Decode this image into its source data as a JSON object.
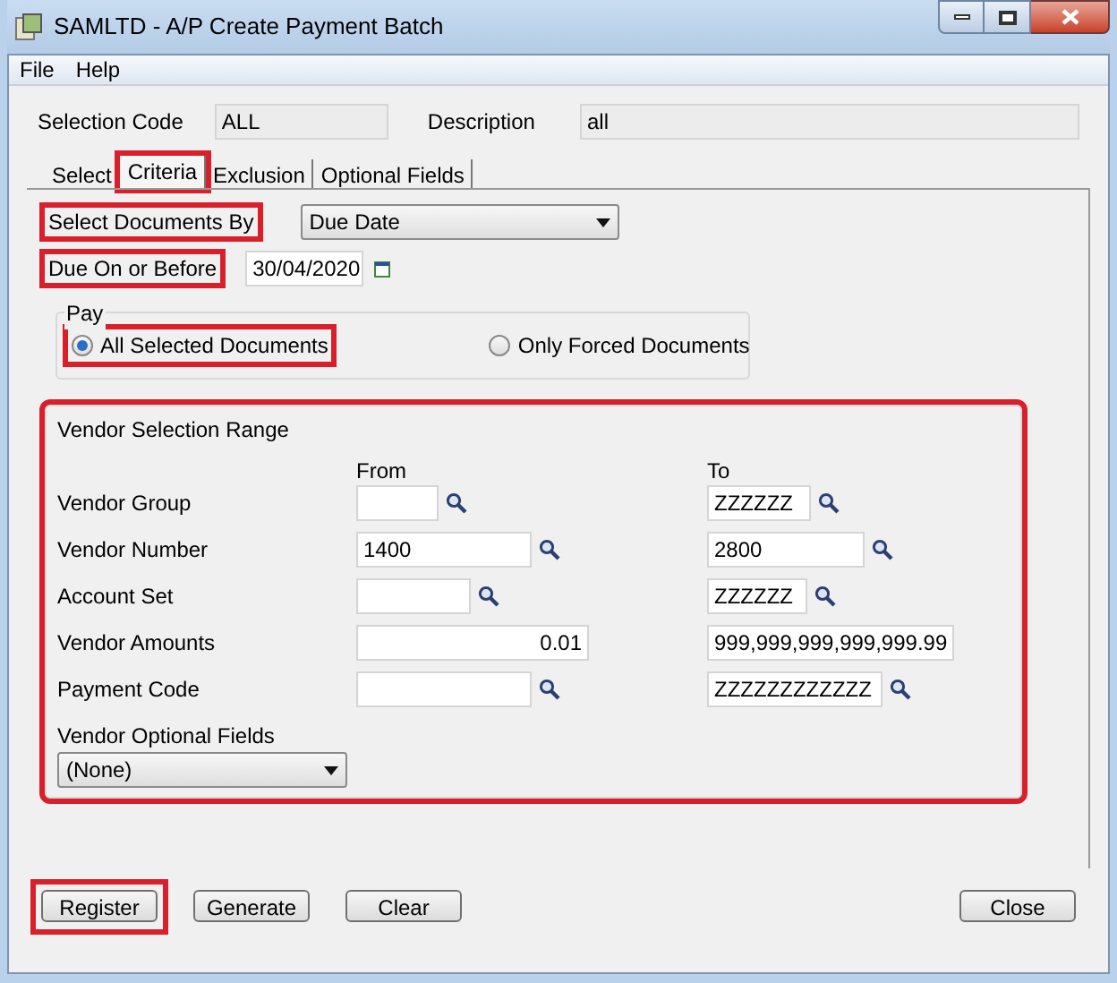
{
  "window": {
    "title": "SAMLTD - A/P Create Payment Batch"
  },
  "menu": [
    "File",
    "Help"
  ],
  "header": {
    "selection_code_label": "Selection Code",
    "selection_code": "ALL",
    "description_label": "Description",
    "description": "all"
  },
  "tabs": [
    {
      "label": "Select",
      "selected": false,
      "highlighted": false
    },
    {
      "label": "Criteria",
      "selected": true,
      "highlighted": true
    },
    {
      "label": "Exclusion",
      "selected": false,
      "highlighted": false
    },
    {
      "label": "Optional Fields",
      "selected": false,
      "highlighted": false
    }
  ],
  "select_documents_by": {
    "label": "Select Documents By",
    "highlighted": true,
    "value": "Due Date"
  },
  "due_on_or_before": {
    "label": "Due On or Before",
    "highlighted": true,
    "value": "30/04/2020"
  },
  "pay": {
    "title": "Pay",
    "options": [
      {
        "label": "All Selected Documents",
        "selected": true,
        "highlighted": true
      },
      {
        "label": "Only Forced Documents",
        "selected": false,
        "highlighted": false
      }
    ]
  },
  "vendor_selection_range": {
    "title": "Vendor Selection Range",
    "highlighted": true,
    "from_label": "From",
    "to_label": "To",
    "rows": [
      {
        "label": "Vendor Group",
        "kind": "lookup",
        "to": "ZZZZZZ"
      },
      {
        "label": "Vendor Number",
        "kind": "lookup",
        "from": "1400",
        "to": "2800"
      },
      {
        "label": "Account Set",
        "kind": "lookup",
        "to": "ZZZZZZ"
      },
      {
        "label": "Vendor Amounts",
        "kind": "amount",
        "from": "0.01",
        "to": "999,999,999,999,999.99"
      },
      {
        "label": "Payment Code",
        "kind": "lookup",
        "to": "ZZZZZZZZZZZZ"
      }
    ],
    "optional_fields_label": "Vendor Optional Fields",
    "optional_fields_value": "(None)"
  },
  "buttons": [
    {
      "label": "Register",
      "highlighted": true
    },
    {
      "label": "Generate",
      "highlighted": false
    },
    {
      "label": "Clear",
      "highlighted": false
    },
    {
      "label": "Close",
      "highlighted": false
    }
  ]
}
